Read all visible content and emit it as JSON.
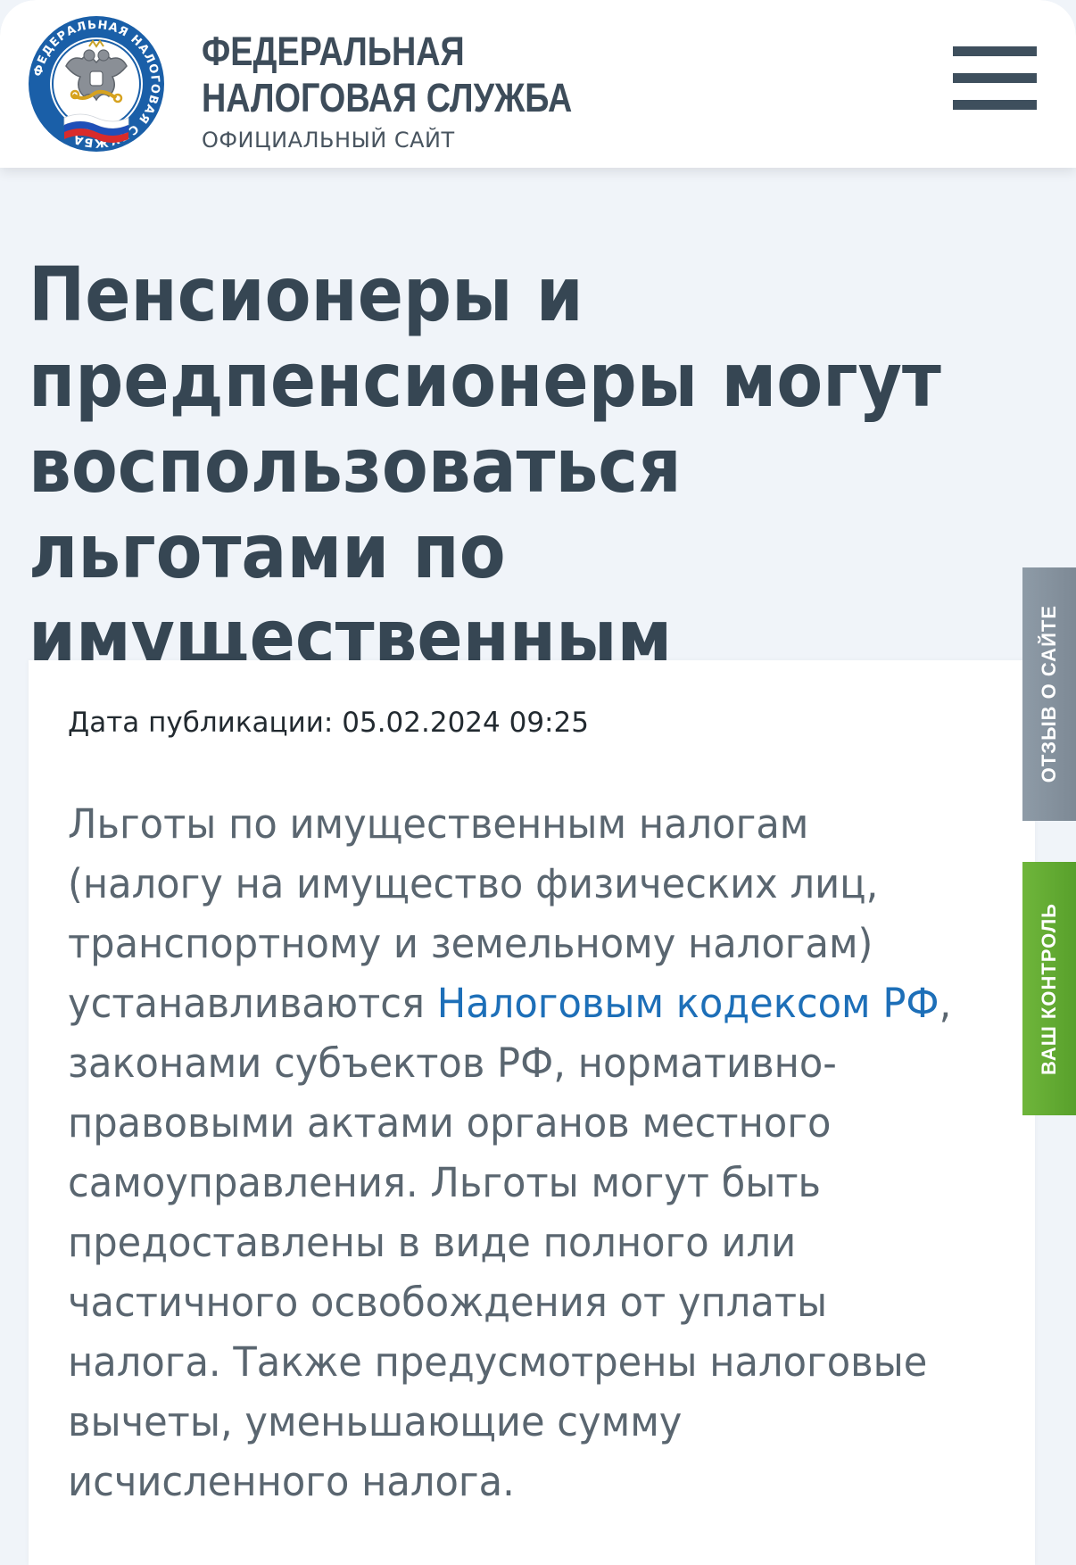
{
  "header": {
    "brand_line1": "ФЕДЕРАЛЬНАЯ",
    "brand_line2": "НАЛОГОВАЯ СЛУЖБА",
    "brand_subtitle": "ОФИЦИАЛЬНЫЙ САЙТ",
    "logo_ring_text": "ФЕДЕРАЛЬНАЯ НАЛОГОВАЯ СЛУЖБА",
    "menu_icon": "hamburger-menu-icon"
  },
  "article": {
    "title": "Пенсионеры и предпенсионеры могут воспользоваться льготами по имущественным налогам",
    "publication_date_label": "Дата публикации:",
    "publication_date_value": "05.02.2024 09:25",
    "body_before_link": "Льготы по имущественным налогам (налогу на имущество физических лиц, транспортному и земельному налогам) устанавливаются ",
    "body_link": "Налоговым кодексом РФ",
    "body_after_link": ", законами субъектов РФ, нормативно-правовыми актами органов местного самоуправления. Льготы могут быть предоставлены в виде полного или частичного освобождения от уплаты налога. Также предусмотрены налоговые вычеты, уменьшающие сумму исчисленного налога."
  },
  "side_tabs": {
    "feedback_label": "ОТЗЫВ О САЙТЕ",
    "control_label": "ВАШ КОНТРОЛЬ"
  },
  "colors": {
    "background": "#f0f4f9",
    "title": "#364653",
    "body_text": "#5a6670",
    "link": "#1d6fb8",
    "feedback_tab": "#8e9ba7",
    "control_tab": "#6fb63b",
    "logo_blue": "#1a5fa8"
  }
}
